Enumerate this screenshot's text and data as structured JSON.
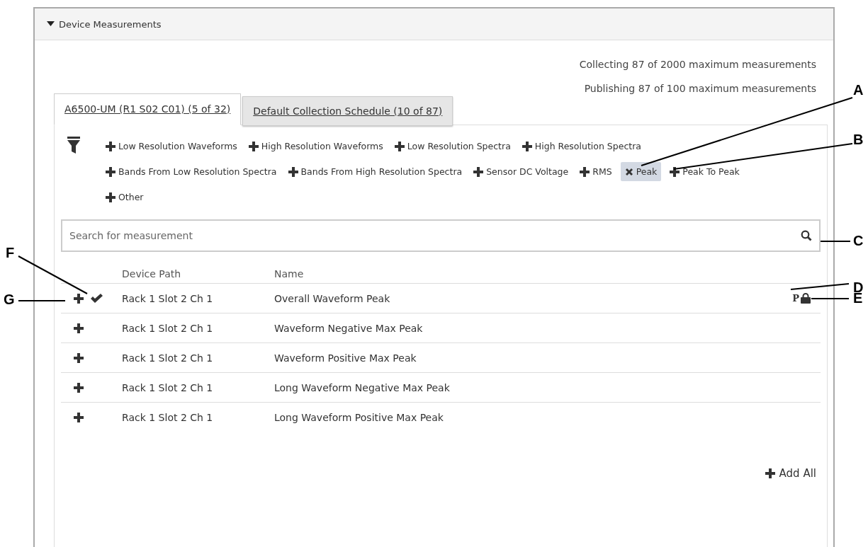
{
  "section": {
    "title": "Device Measurements",
    "expanded": true
  },
  "summary": [
    "Collecting 87 of 2000 maximum measurements",
    "Publishing 87 of 100 maximum measurements"
  ],
  "tabs": [
    {
      "label": "A6500-UM (R1 S02 C01) (5 of 32)",
      "selected": true
    },
    {
      "label": "Default Collection Schedule (10 of 87)",
      "selected": false
    }
  ],
  "filters": [
    {
      "label": "Low Resolution Waveforms",
      "selected": false
    },
    {
      "label": "High Resolution Waveforms",
      "selected": false
    },
    {
      "label": "Low Resolution Spectra",
      "selected": false
    },
    {
      "label": "High Resolution Spectra",
      "selected": false
    },
    {
      "label": "Bands From Low Resolution Spectra",
      "selected": false
    },
    {
      "label": "Bands From High Resolution Spectra",
      "selected": false
    },
    {
      "label": "Sensor DC Voltage",
      "selected": false
    },
    {
      "label": "RMS",
      "selected": false
    },
    {
      "label": "Peak",
      "selected": true
    },
    {
      "label": "Peak To Peak",
      "selected": false
    },
    {
      "label": "Other",
      "selected": false
    }
  ],
  "search": {
    "placeholder": "Search for measurement"
  },
  "table": {
    "columns": [
      "Device Path",
      "Name"
    ],
    "rows": [
      {
        "path": "Rack 1 Slot 2 Ch 1",
        "name": "Overall Waveform Peak",
        "added": true,
        "badge": "P",
        "locked": true
      },
      {
        "path": "Rack 1 Slot 2 Ch 1",
        "name": "Waveform Negative Max Peak",
        "added": false,
        "locked": false
      },
      {
        "path": "Rack 1 Slot 2 Ch 1",
        "name": "Waveform Positive Max Peak",
        "added": false,
        "locked": false
      },
      {
        "path": "Rack 1 Slot 2 Ch 1",
        "name": "Long Waveform Negative Max Peak",
        "added": false,
        "locked": false
      },
      {
        "path": "Rack 1 Slot 2 Ch 1",
        "name": "Long Waveform Positive Max Peak",
        "added": false,
        "locked": false
      }
    ]
  },
  "add_all": "Add All",
  "callouts": [
    "A",
    "B",
    "C",
    "D",
    "E",
    "F",
    "G"
  ]
}
